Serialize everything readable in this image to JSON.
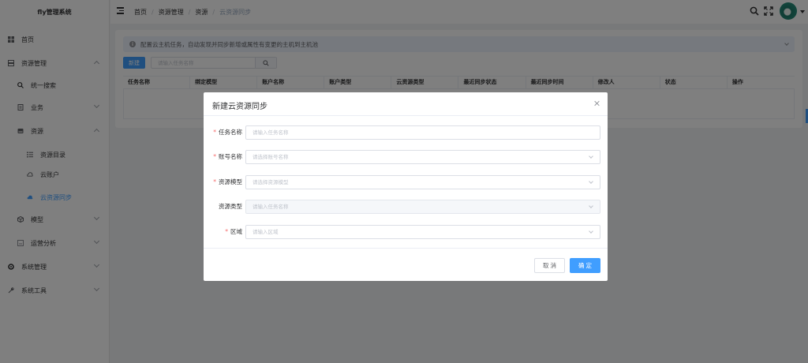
{
  "app": {
    "title": "fly管理系统"
  },
  "sidebar": {
    "items": [
      {
        "label": "首页",
        "icon": "dashboard-icon"
      },
      {
        "label": "资源管理",
        "icon": "server-icon",
        "expanded": true
      },
      {
        "label": "统一搜索",
        "icon": "search-icon"
      },
      {
        "label": "业务",
        "icon": "document-icon"
      },
      {
        "label": "资源",
        "icon": "drive-icon",
        "expanded": true
      },
      {
        "label": "资源目录",
        "icon": "list-icon"
      },
      {
        "label": "云账户",
        "icon": "cloud-icon"
      },
      {
        "label": "云资源同步",
        "icon": "sync-icon",
        "active": true
      },
      {
        "label": "模型",
        "icon": "cube-icon"
      },
      {
        "label": "运营分析",
        "icon": "chart-icon"
      },
      {
        "label": "系统管理",
        "icon": "gear-icon"
      },
      {
        "label": "系统工具",
        "icon": "tools-icon"
      }
    ]
  },
  "header": {
    "breadcrumb": [
      "首页",
      "资源管理",
      "资源",
      "云资源同步"
    ]
  },
  "main": {
    "alert": "配置云主机任务，自动发现并同步新增或属性有变更的主机到主机池",
    "new_button": "新建",
    "search_placeholder": "请输入任务名称",
    "columns": [
      "任务名称",
      "绑定模型",
      "账户名称",
      "账户类型",
      "云资源类型",
      "最近同步状态",
      "最近同步时间",
      "修改人",
      "状态",
      "操作"
    ]
  },
  "dialog": {
    "title": "新建云资源同步",
    "fields": [
      {
        "label": "任务名称",
        "required": true,
        "placeholder": "请输入任务名称",
        "type": "input"
      },
      {
        "label": "账号名称",
        "required": true,
        "placeholder": "请选择账号名称",
        "type": "select"
      },
      {
        "label": "资源模型",
        "required": true,
        "placeholder": "请选择资源模型",
        "type": "select"
      },
      {
        "label": "资源类型",
        "required": false,
        "placeholder": "请输入任务名称",
        "type": "select",
        "disabled": true
      },
      {
        "label": "区域",
        "required": true,
        "placeholder": "请输入区域",
        "type": "select"
      }
    ],
    "cancel_label": "取 消",
    "ok_label": "确 定"
  },
  "colors": {
    "primary": "#409eff",
    "required": "#f56c6c",
    "overlay": "rgba(0,0,0,0.5)"
  }
}
